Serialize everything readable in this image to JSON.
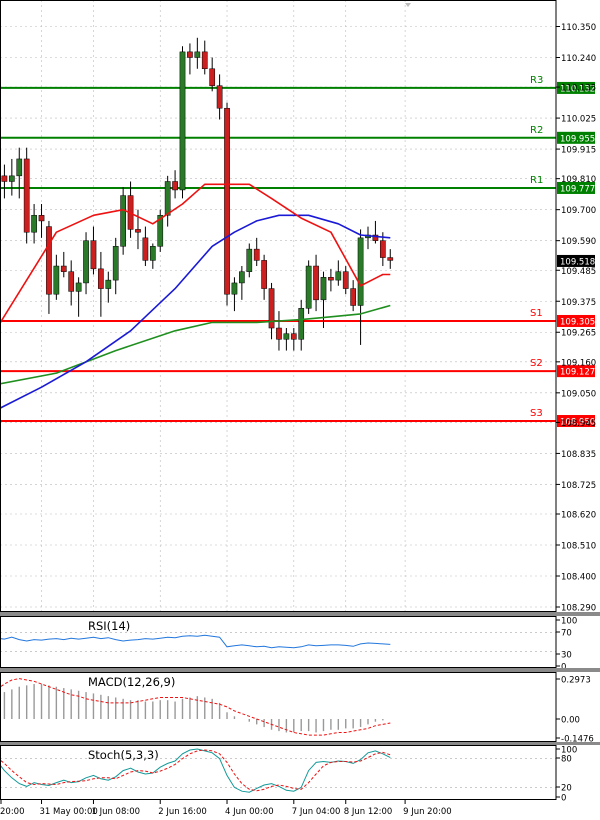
{
  "chart_data": {
    "type": "candlestick",
    "main": {
      "ylim": [
        108.25,
        110.4
      ],
      "yticks": [
        "110.350",
        "110.240",
        "110.135",
        "110.025",
        "109.915",
        "109.810",
        "109.700",
        "109.590",
        "109.485",
        "109.375",
        "109.265",
        "109.160",
        "109.050",
        "108.945",
        "108.835",
        "108.725",
        "108.620",
        "108.510",
        "108.400",
        "108.290"
      ],
      "current_price": {
        "label": "109.518",
        "value": 109.518
      },
      "levels": [
        {
          "name": "R3",
          "label": "110.132",
          "value": 110.132,
          "color": "#008000"
        },
        {
          "name": "R2",
          "label": "109.955",
          "value": 109.955,
          "color": "#008000"
        },
        {
          "name": "R1",
          "label": "109.777",
          "value": 109.777,
          "color": "#008000"
        },
        {
          "name": "S1",
          "label": "109.305",
          "value": 109.305,
          "color": "#ff0000"
        },
        {
          "name": "S2",
          "label": "109.127",
          "value": 109.127,
          "color": "#ff0000"
        },
        {
          "name": "S3",
          "label": "108.950",
          "value": 108.95,
          "color": "#ff0000"
        }
      ],
      "candles": [
        [
          110.04,
          110.16,
          109.84,
          109.82
        ],
        [
          109.82,
          109.86,
          109.74,
          109.8
        ],
        [
          109.8,
          109.88,
          109.75,
          109.82
        ],
        [
          109.82,
          109.92,
          109.74,
          109.88
        ],
        [
          109.88,
          109.92,
          109.58,
          109.62
        ],
        [
          109.62,
          109.72,
          109.58,
          109.68
        ],
        [
          109.68,
          109.72,
          109.6,
          109.66
        ],
        [
          109.64,
          109.66,
          109.33,
          109.4
        ],
        [
          109.4,
          109.54,
          109.38,
          109.5
        ],
        [
          109.5,
          109.55,
          109.46,
          109.48
        ],
        [
          109.48,
          109.52,
          109.36,
          109.41
        ],
        [
          109.41,
          109.46,
          109.32,
          109.44
        ],
        [
          109.44,
          109.62,
          109.4,
          109.59
        ],
        [
          109.59,
          109.64,
          109.47,
          109.49
        ],
        [
          109.49,
          109.55,
          109.32,
          109.42
        ],
        [
          109.42,
          109.48,
          109.37,
          109.45
        ],
        [
          109.45,
          109.6,
          109.4,
          109.57
        ],
        [
          109.57,
          109.78,
          109.54,
          109.75
        ],
        [
          109.75,
          109.8,
          109.6,
          109.63
        ],
        [
          109.63,
          109.7,
          109.56,
          109.62
        ],
        [
          109.6,
          109.64,
          109.5,
          109.52
        ],
        [
          109.52,
          109.58,
          109.49,
          109.57
        ],
        [
          109.57,
          109.7,
          109.55,
          109.68
        ],
        [
          109.68,
          109.82,
          109.64,
          109.8
        ],
        [
          109.8,
          109.84,
          109.74,
          109.77
        ],
        [
          109.77,
          110.28,
          109.74,
          110.26
        ],
        [
          110.26,
          110.29,
          110.18,
          110.24
        ],
        [
          110.24,
          110.31,
          110.2,
          110.26
        ],
        [
          110.26,
          110.3,
          110.18,
          110.2
        ],
        [
          110.2,
          110.24,
          110.12,
          110.14
        ],
        [
          110.14,
          110.18,
          110.02,
          110.06
        ],
        [
          110.06,
          110.08,
          109.36,
          109.4
        ],
        [
          109.4,
          109.46,
          109.34,
          109.44
        ],
        [
          109.44,
          109.5,
          109.38,
          109.48
        ],
        [
          109.48,
          109.58,
          109.46,
          109.56
        ],
        [
          109.56,
          109.6,
          109.5,
          109.52
        ],
        [
          109.52,
          109.54,
          109.38,
          109.42
        ],
        [
          109.42,
          109.44,
          109.24,
          109.28
        ],
        [
          109.28,
          109.34,
          109.2,
          109.24
        ],
        [
          109.24,
          109.28,
          109.2,
          109.26
        ],
        [
          109.26,
          109.28,
          109.2,
          109.24
        ],
        [
          109.24,
          109.38,
          109.2,
          109.35
        ],
        [
          109.35,
          109.52,
          109.33,
          109.5
        ],
        [
          109.5,
          109.54,
          109.34,
          109.38
        ],
        [
          109.38,
          109.48,
          109.28,
          109.46
        ],
        [
          109.46,
          109.49,
          109.41,
          109.45
        ],
        [
          109.45,
          109.52,
          109.43,
          109.48
        ],
        [
          109.48,
          109.5,
          109.4,
          109.42
        ],
        [
          109.42,
          109.45,
          109.34,
          109.36
        ],
        [
          109.36,
          109.63,
          109.22,
          109.6
        ],
        [
          109.6,
          109.64,
          109.56,
          109.61
        ],
        [
          109.61,
          109.66,
          109.58,
          109.59
        ],
        [
          109.59,
          109.62,
          109.5,
          109.53
        ],
        [
          109.53,
          109.56,
          109.49,
          109.52
        ]
      ],
      "ma_red": [
        [
          0,
          109.28
        ],
        [
          4,
          109.45
        ],
        [
          8,
          109.62
        ],
        [
          13,
          109.68
        ],
        [
          17,
          109.7
        ],
        [
          21,
          109.65
        ],
        [
          25,
          109.72
        ],
        [
          28,
          109.79
        ],
        [
          31,
          109.79
        ],
        [
          34,
          109.79
        ],
        [
          37,
          109.74
        ],
        [
          41,
          109.67
        ],
        [
          45,
          109.62
        ],
        [
          49,
          109.43
        ],
        [
          52,
          109.47
        ],
        [
          53,
          109.47
        ]
      ],
      "ma_blue": [
        [
          0,
          108.99
        ],
        [
          6,
          109.07
        ],
        [
          12,
          109.16
        ],
        [
          18,
          109.27
        ],
        [
          24,
          109.42
        ],
        [
          29,
          109.57
        ],
        [
          32,
          109.62
        ],
        [
          35,
          109.66
        ],
        [
          38,
          109.68
        ],
        [
          42,
          109.68
        ],
        [
          46,
          109.65
        ],
        [
          49,
          109.61
        ],
        [
          53,
          109.6
        ]
      ],
      "ma_green": [
        [
          0,
          109.08
        ],
        [
          8,
          109.12
        ],
        [
          16,
          109.2
        ],
        [
          24,
          109.27
        ],
        [
          29,
          109.3
        ],
        [
          35,
          109.3
        ],
        [
          41,
          109.31
        ],
        [
          45,
          109.32
        ],
        [
          49,
          109.33
        ],
        [
          53,
          109.36
        ]
      ]
    },
    "rsi": {
      "label": "RSI(14)",
      "ticks": [
        "100",
        "70",
        "30",
        "0"
      ],
      "values": [
        58,
        56,
        60,
        55,
        52,
        55,
        54,
        56,
        57,
        55,
        58,
        56,
        58,
        60,
        57,
        59,
        55,
        52,
        54,
        55,
        57,
        56,
        58,
        60,
        59,
        62,
        63,
        62,
        64,
        62,
        60,
        40,
        42,
        44,
        42,
        40,
        41,
        38,
        40,
        39,
        38,
        40,
        44,
        42,
        43,
        44,
        44,
        43,
        41,
        46,
        48,
        47,
        46,
        45
      ]
    },
    "macd": {
      "label": "MACD(12,26,9)",
      "ticks": [
        "0.2973",
        "0.00",
        "-0.1476"
      ],
      "histogram": [
        0.18,
        0.2,
        0.22,
        0.24,
        0.25,
        0.26,
        0.26,
        0.25,
        0.24,
        0.23,
        0.22,
        0.21,
        0.2,
        0.19,
        0.18,
        0.17,
        0.16,
        0.15,
        0.14,
        0.14,
        0.13,
        0.13,
        0.14,
        0.14,
        0.13,
        0.15,
        0.16,
        0.17,
        0.16,
        0.15,
        0.12,
        0.05,
        0.02,
        0.0,
        -0.02,
        -0.04,
        -0.06,
        -0.08,
        -0.09,
        -0.1,
        -0.1,
        -0.09,
        -0.09,
        -0.1,
        -0.09,
        -0.08,
        -0.08,
        -0.07,
        -0.07,
        -0.06,
        -0.04,
        -0.02,
        -0.01,
        0.0
      ],
      "signal": [
        0.22,
        0.26,
        0.29,
        0.3,
        0.29,
        0.28,
        0.26,
        0.24,
        0.22,
        0.2,
        0.18,
        0.17,
        0.15,
        0.14,
        0.13,
        0.12,
        0.12,
        0.12,
        0.12,
        0.13,
        0.14,
        0.15,
        0.16,
        0.16,
        0.16,
        0.16,
        0.15,
        0.14,
        0.13,
        0.12,
        0.11,
        0.09,
        0.06,
        0.04,
        0.02,
        0.0,
        -0.02,
        -0.04,
        -0.06,
        -0.08,
        -0.1,
        -0.11,
        -0.12,
        -0.12,
        -0.12,
        -0.11,
        -0.1,
        -0.1,
        -0.09,
        -0.08,
        -0.07,
        -0.05,
        -0.04,
        -0.03
      ]
    },
    "stoch": {
      "label": "Stoch(5,3,3)",
      "ticks": [
        "100",
        "80",
        "20",
        "0"
      ],
      "k": [
        75,
        55,
        40,
        28,
        22,
        30,
        26,
        24,
        30,
        35,
        30,
        32,
        40,
        45,
        38,
        35,
        42,
        55,
        60,
        52,
        48,
        50,
        62,
        70,
        75,
        90,
        98,
        100,
        96,
        92,
        80,
        45,
        20,
        12,
        10,
        18,
        25,
        28,
        22,
        14,
        12,
        20,
        55,
        72,
        74,
        72,
        75,
        74,
        70,
        78,
        92,
        96,
        90,
        82
      ],
      "d": [
        82,
        70,
        55,
        42,
        30,
        26,
        28,
        27,
        26,
        30,
        32,
        33,
        34,
        38,
        40,
        40,
        38,
        45,
        52,
        55,
        54,
        50,
        54,
        60,
        68,
        80,
        90,
        96,
        98,
        96,
        90,
        72,
        48,
        28,
        16,
        13,
        16,
        22,
        25,
        22,
        18,
        16,
        30,
        48,
        65,
        72,
        74,
        74,
        73,
        75,
        82,
        90,
        93,
        88
      ]
    },
    "xlabels": [
      {
        "text": "20:00",
        "i": 0
      },
      {
        "text": "31 May 00:00",
        "i": 6
      },
      {
        "text": "1 Jun 08:00",
        "i": 13
      },
      {
        "text": "2 Jun 16:00",
        "i": 22
      },
      {
        "text": "4 Jun 00:00",
        "i": 31
      },
      {
        "text": "7 Jun 04:00",
        "i": 40
      },
      {
        "text": "8 Jun 12:00",
        "i": 47
      },
      {
        "text": "9 Jun 20:00",
        "i": 55
      }
    ]
  }
}
